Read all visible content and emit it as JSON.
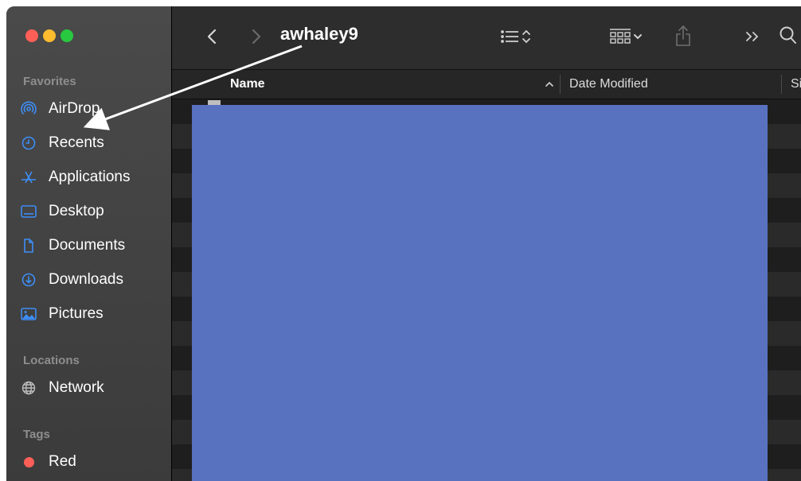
{
  "window": {
    "title": "awhaley9"
  },
  "sidebar": {
    "favorites_title": "Favorites",
    "favorites": [
      {
        "label": "AirDrop",
        "icon": "airdrop-icon"
      },
      {
        "label": "Recents",
        "icon": "clock-icon"
      },
      {
        "label": "Applications",
        "icon": "applications-icon"
      },
      {
        "label": "Desktop",
        "icon": "desktop-icon"
      },
      {
        "label": "Documents",
        "icon": "document-icon"
      },
      {
        "label": "Downloads",
        "icon": "download-icon"
      },
      {
        "label": "Pictures",
        "icon": "pictures-icon"
      }
    ],
    "locations_title": "Locations",
    "locations": [
      {
        "label": "Network",
        "icon": "globe-icon"
      }
    ],
    "tags_title": "Tags",
    "tags": [
      {
        "label": "Red",
        "color": "#ff5f57"
      }
    ]
  },
  "toolbar": {
    "icons": [
      "back-icon",
      "forward-icon",
      "list-view-icon",
      "sort-chevron-icon",
      "group-grid-icon",
      "share-icon",
      "more-icon",
      "search-icon"
    ]
  },
  "columns": {
    "name": "Name",
    "date_modified": "Date Modified",
    "size_truncated": "Si"
  },
  "colors": {
    "accent": "#3d8ef7",
    "redaction": "#5872c0",
    "close": "#ff5f57",
    "minimize": "#febc2e",
    "maximize": "#28c840"
  }
}
